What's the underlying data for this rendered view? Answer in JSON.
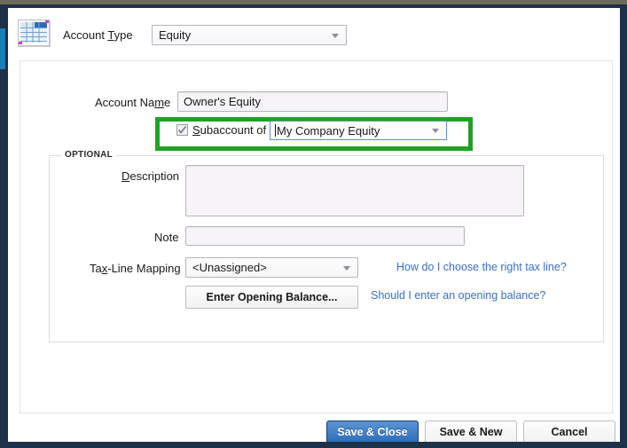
{
  "dialog": {
    "icon_name": "account-spreadsheet-icon"
  },
  "header": {
    "account_type_label_pre": "Account ",
    "account_type_label_mnemonic": "T",
    "account_type_label_post": "ype",
    "account_type_value": "Equity"
  },
  "form": {
    "account_name_label_pre": "Account Na",
    "account_name_label_mnemonic": "m",
    "account_name_label_post": "e",
    "account_name_value": "Owner's Equity",
    "subaccount_label_mnemonic": "S",
    "subaccount_label_post": "ubaccount of",
    "subaccount_checked": true,
    "parent_account_value": "My Company Equity"
  },
  "optional": {
    "legend": "OPTIONAL",
    "description_label_mnemonic": "D",
    "description_label_post": "escription",
    "description_value": "",
    "note_label": "Note",
    "note_value": "",
    "taxline_label_pre": "Ta",
    "taxline_label_mnemonic": "x",
    "taxline_label_post": "-Line Mapping",
    "taxline_value": "<Unassigned>",
    "taxline_link": "How do I choose the right tax line?",
    "opening_balance_button_pre": "Enter Openin",
    "opening_balance_button_mnemonic": "g",
    "opening_balance_button_post": " Balance...",
    "opening_balance_link": "Should I enter an opening balance?"
  },
  "footer": {
    "save_close_label": "Save & Close",
    "save_new_label": "Save & New",
    "cancel_label": "Cancel"
  },
  "colors": {
    "window_frame": "#1d3149",
    "highlight_green": "#22a125",
    "link_blue": "#3b6fc6",
    "primary_button_blue": "#2f6cb5",
    "focus_border_blue": "#5b8fd0"
  }
}
